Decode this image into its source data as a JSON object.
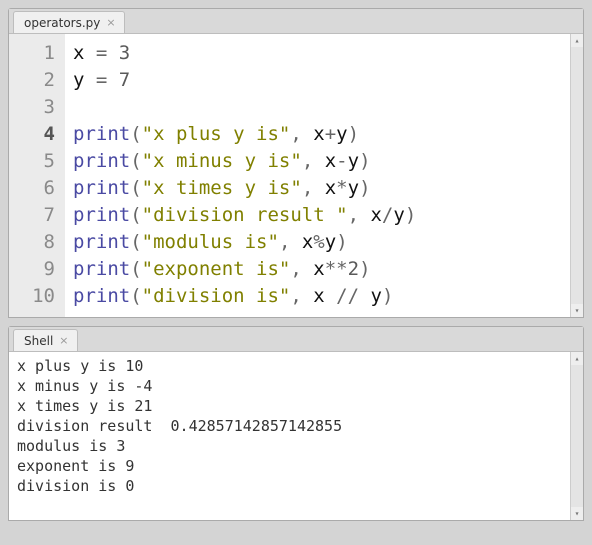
{
  "editor": {
    "tab_label": "operators.py",
    "current_line_index": 3,
    "tokens": [
      [
        [
          "ident",
          "x"
        ],
        [
          "op",
          " = "
        ],
        [
          "num",
          "3"
        ]
      ],
      [
        [
          "ident",
          "y"
        ],
        [
          "op",
          " = "
        ],
        [
          "num",
          "7"
        ]
      ],
      [],
      [
        [
          "fn",
          "print"
        ],
        [
          "paren",
          "("
        ],
        [
          "str",
          "\"x plus y is\""
        ],
        [
          "op",
          ", "
        ],
        [
          "ident",
          "x"
        ],
        [
          "op",
          "+"
        ],
        [
          "ident",
          "y"
        ],
        [
          "paren",
          ")"
        ]
      ],
      [
        [
          "fn",
          "print"
        ],
        [
          "paren",
          "("
        ],
        [
          "str",
          "\"x minus y is\""
        ],
        [
          "op",
          ", "
        ],
        [
          "ident",
          "x"
        ],
        [
          "op",
          "-"
        ],
        [
          "ident",
          "y"
        ],
        [
          "paren",
          ")"
        ]
      ],
      [
        [
          "fn",
          "print"
        ],
        [
          "paren",
          "("
        ],
        [
          "str",
          "\"x times y is\""
        ],
        [
          "op",
          ", "
        ],
        [
          "ident",
          "x"
        ],
        [
          "op",
          "*"
        ],
        [
          "ident",
          "y"
        ],
        [
          "paren",
          ")"
        ]
      ],
      [
        [
          "fn",
          "print"
        ],
        [
          "paren",
          "("
        ],
        [
          "str",
          "\"division result \""
        ],
        [
          "op",
          ", "
        ],
        [
          "ident",
          "x"
        ],
        [
          "op",
          "/"
        ],
        [
          "ident",
          "y"
        ],
        [
          "paren",
          ")"
        ]
      ],
      [
        [
          "fn",
          "print"
        ],
        [
          "paren",
          "("
        ],
        [
          "str",
          "\"modulus is\""
        ],
        [
          "op",
          ", "
        ],
        [
          "ident",
          "x"
        ],
        [
          "op",
          "%"
        ],
        [
          "ident",
          "y"
        ],
        [
          "paren",
          ")"
        ]
      ],
      [
        [
          "fn",
          "print"
        ],
        [
          "paren",
          "("
        ],
        [
          "str",
          "\"exponent is\""
        ],
        [
          "op",
          ", "
        ],
        [
          "ident",
          "x"
        ],
        [
          "op",
          "**"
        ],
        [
          "num",
          "2"
        ],
        [
          "paren",
          ")"
        ]
      ],
      [
        [
          "fn",
          "print"
        ],
        [
          "paren",
          "("
        ],
        [
          "str",
          "\"division is\""
        ],
        [
          "op",
          ", "
        ],
        [
          "ident",
          "x"
        ],
        [
          "op",
          " // "
        ],
        [
          "ident",
          "y"
        ],
        [
          "paren",
          ")"
        ]
      ]
    ]
  },
  "shell": {
    "tab_label": "Shell",
    "output_lines": [
      "x plus y is 10",
      "x minus y is -4",
      "x times y is 21",
      "division result  0.42857142857142855",
      "modulus is 3",
      "exponent is 9",
      "division is 0"
    ]
  }
}
